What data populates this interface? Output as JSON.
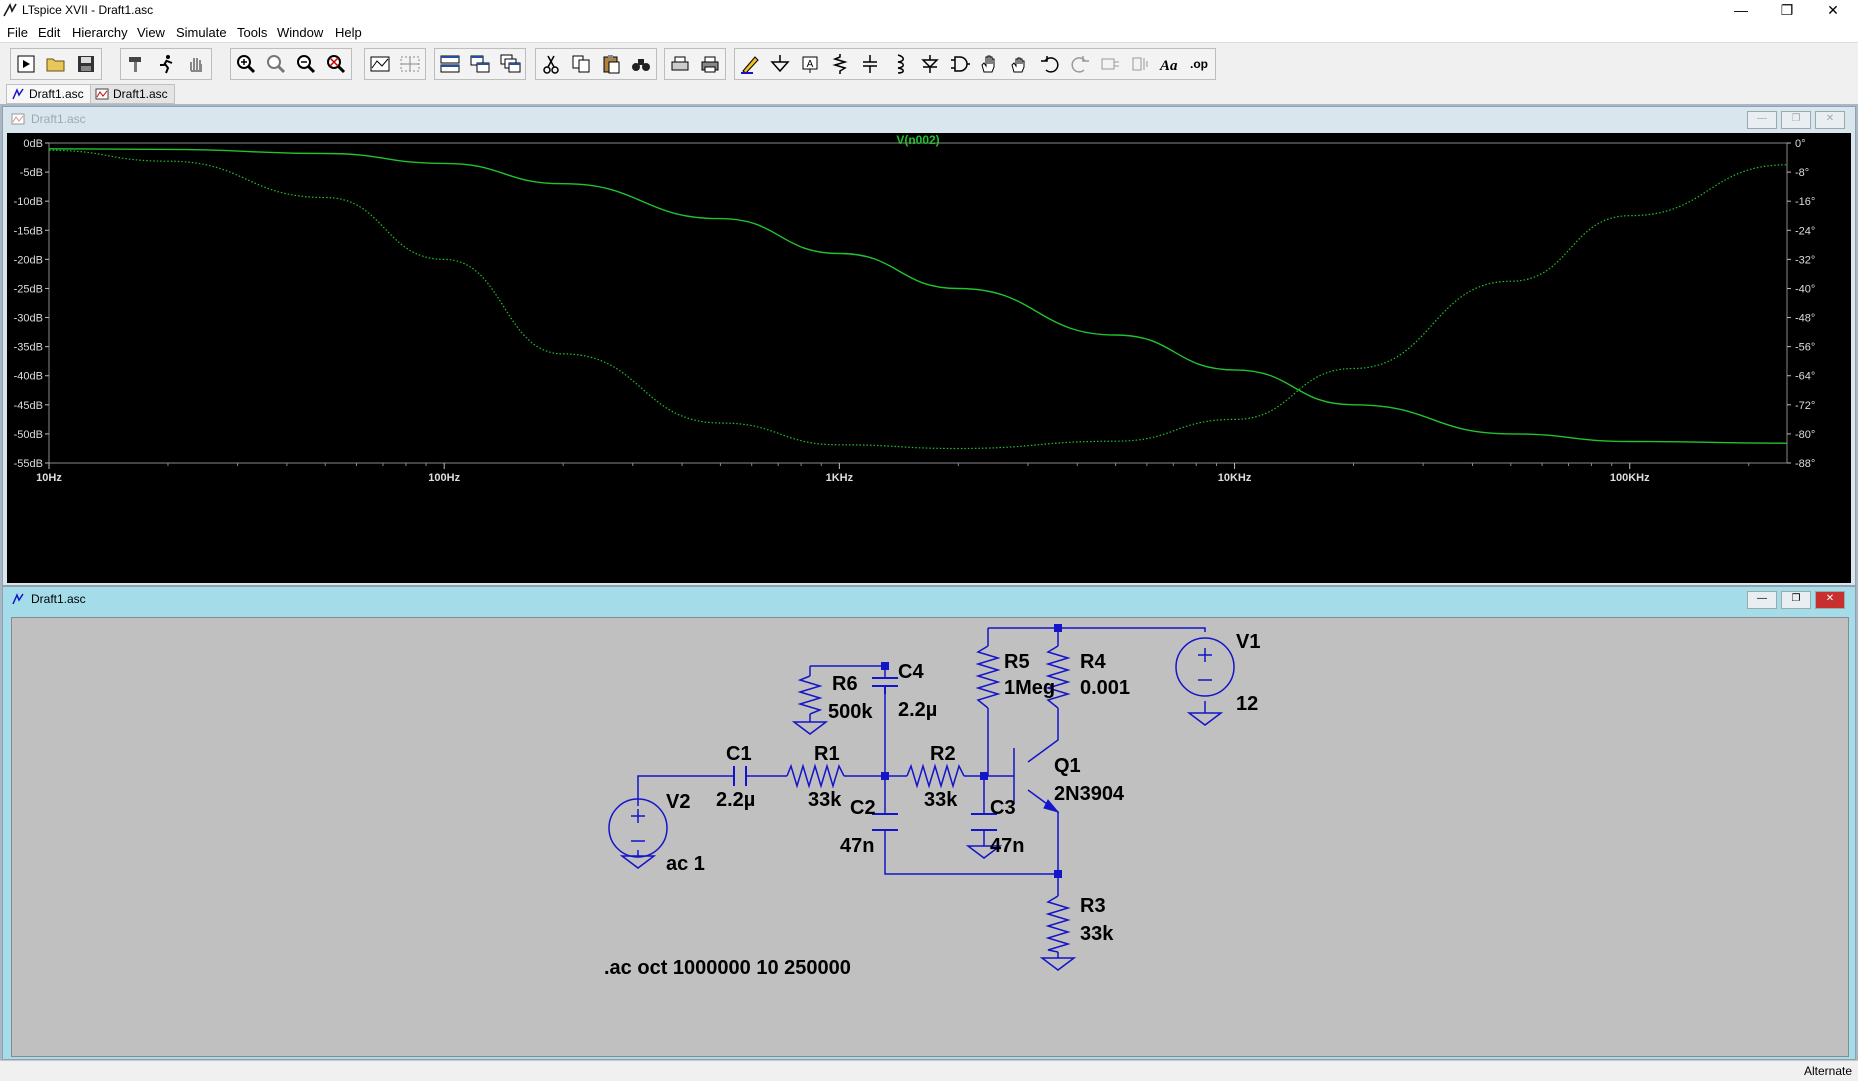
{
  "window": {
    "title": "LTspice XVII - Draft1.asc"
  },
  "menu": [
    "File",
    "Edit",
    "Hierarchy",
    "View",
    "Simulate",
    "Tools",
    "Window",
    "Help"
  ],
  "doc_tabs": [
    {
      "label": "Draft1.asc",
      "kind": "schematic"
    },
    {
      "label": "Draft1.asc",
      "kind": "waveform"
    }
  ],
  "waveform_window": {
    "title": "Draft1.asc",
    "trace_label": "V(n002)"
  },
  "schematic_window": {
    "title": "Draft1.asc"
  },
  "statusbar": {
    "text": "Alternate"
  },
  "colors": {
    "trace": "#22c22e",
    "plot_bg": "#000000",
    "wire": "#1414c8",
    "schematic_bg": "#c0c0c0"
  },
  "chart_data": {
    "type": "line",
    "x_axis": {
      "scale": "log",
      "ticks": [
        "10Hz",
        "100Hz",
        "1KHz",
        "10KHz",
        "100KHz"
      ]
    },
    "y_left": {
      "ticks": [
        "0dB",
        "-5dB",
        "-10dB",
        "-15dB",
        "-20dB",
        "-25dB",
        "-30dB",
        "-35dB",
        "-40dB",
        "-45dB",
        "-50dB",
        "-55dB"
      ],
      "ylim": [
        -55,
        0
      ]
    },
    "y_right": {
      "ticks": [
        "0°",
        "-8°",
        "-16°",
        "-24°",
        "-32°",
        "-40°",
        "-48°",
        "-56°",
        "-64°",
        "-72°",
        "-80°",
        "-88°"
      ],
      "ylim": [
        -88,
        0
      ]
    },
    "series": [
      {
        "name": "V(n002)",
        "style": "solid",
        "axis": "left",
        "x": [
          10,
          20,
          50,
          100,
          200,
          500,
          1000,
          2000,
          5000,
          10000,
          20000,
          50000,
          100000,
          250000
        ],
        "y": [
          -1,
          -1.1,
          -1.8,
          -3.5,
          -7,
          -13,
          -19,
          -25,
          -33,
          -39,
          -45,
          -50,
          -51.3,
          -51.6
        ]
      },
      {
        "name": "V(n002) phase",
        "style": "dotted",
        "axis": "right",
        "x": [
          10,
          20,
          50,
          100,
          200,
          500,
          1000,
          2000,
          5000,
          10000,
          20000,
          50000,
          100000,
          250000
        ],
        "y": [
          -2,
          -5,
          -15,
          -32,
          -58,
          -77,
          -83,
          -84,
          -82,
          -76,
          -62,
          -38,
          -20,
          -6
        ]
      }
    ]
  },
  "schematic": {
    "components": [
      {
        "ref": "V1",
        "value": "12"
      },
      {
        "ref": "V2",
        "value": "ac 1"
      },
      {
        "ref": "R1",
        "value": "33k"
      },
      {
        "ref": "R2",
        "value": "33k"
      },
      {
        "ref": "R3",
        "value": "33k"
      },
      {
        "ref": "R4",
        "value": "0.001"
      },
      {
        "ref": "R5",
        "value": "1Meg"
      },
      {
        "ref": "R6",
        "value": "500k"
      },
      {
        "ref": "C1",
        "value": "2.2µ"
      },
      {
        "ref": "C2",
        "value": "47n"
      },
      {
        "ref": "C3",
        "value": "47n"
      },
      {
        "ref": "C4",
        "value": "2.2µ"
      },
      {
        "ref": "Q1",
        "value": "2N3904"
      }
    ],
    "directive": ".ac oct 1000000 10 250000"
  }
}
